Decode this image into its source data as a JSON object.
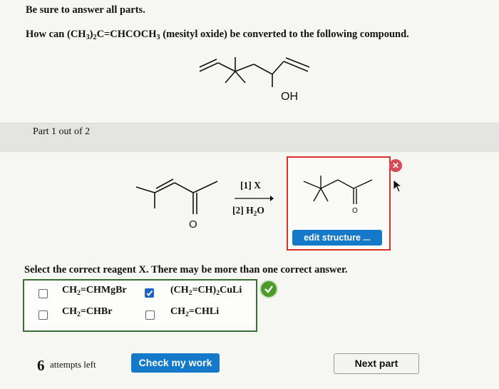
{
  "instructions": "Be sure to answer all parts.",
  "question": {
    "pre": "How can (CH",
    "s1": "3",
    "mid1": ")",
    "s2": "2",
    "mid2": "C=CHCOCH",
    "s3": "3",
    "post": " (mesityl oxide) be converted to the following compound."
  },
  "target_structure": {
    "oh_label": "OH"
  },
  "part": {
    "label": "Part 1 out of 2"
  },
  "reaction": {
    "step1": "[1] X",
    "step2_pre": "[2] H",
    "step2_sub": "2",
    "step2_post": "O",
    "carbonyl_label": "O",
    "product_carbonyl_label": "O"
  },
  "product_box": {
    "edit_label": "edit structure ...",
    "error_icon": "close-icon"
  },
  "select_prompt": "Select the correct reagent X. There may be more than one correct answer.",
  "options": [
    {
      "pre": "CH",
      "sub": "2",
      "post": "=CHMgBr",
      "checked": false
    },
    {
      "pre": "(CH",
      "sub": "2",
      "post": "=CH)",
      "sub2": "2",
      "post2": "CuLi",
      "checked": true
    },
    {
      "pre": "CH",
      "sub": "2",
      "post": "=CHBr",
      "checked": false
    },
    {
      "pre": "CH",
      "sub": "2",
      "post": "=CHLi",
      "checked": false
    }
  ],
  "attempts": {
    "count": "6",
    "label": "attempts left"
  },
  "buttons": {
    "check": "Check my work",
    "next": "Next part"
  },
  "colors": {
    "accent": "#1479c9",
    "error": "#d9302a",
    "correct": "#4c9a2a"
  }
}
